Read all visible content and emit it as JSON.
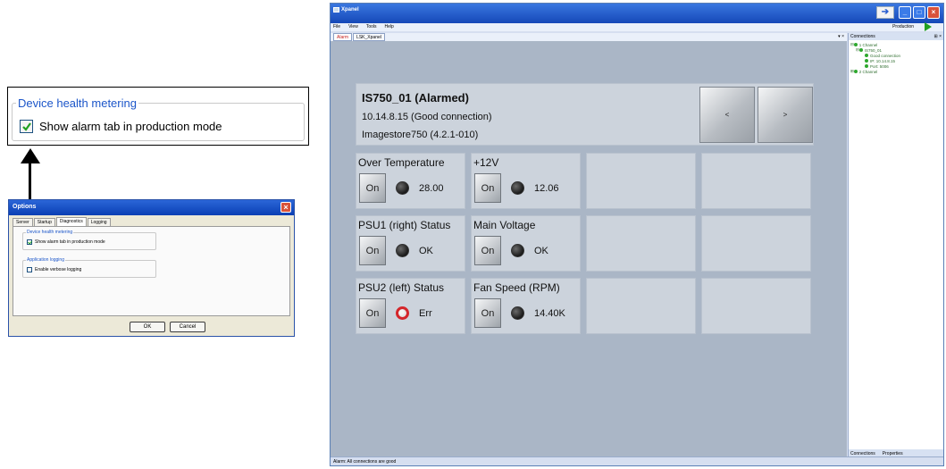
{
  "callout": {
    "legend": "Device health metering",
    "checkbox_label": "Show alarm tab in production mode",
    "checked": true
  },
  "options_dialog": {
    "title": "Options",
    "tabs": [
      "Server",
      "Startup",
      "Diagnostics",
      "Logging"
    ],
    "active_tab": "Diagnostics",
    "group1_legend": "Device health metering",
    "group1_checkbox": "Show alarm tab in production mode",
    "group2_legend": "Application logging",
    "group2_checkbox": "Enable verbose logging",
    "ok": "OK",
    "cancel": "Cancel"
  },
  "xpanel": {
    "title": "Xpanel",
    "menu": [
      "File",
      "View",
      "Tools",
      "Help"
    ],
    "mode_label": "Production",
    "tabs": [
      "Alarm",
      "LSK_Xpanel"
    ],
    "tab_tools": "▾ ×",
    "status": "Alarm: All connections are good",
    "device": {
      "name": "IS750_01 (Alarmed)",
      "ip": "10.14.8.15 (Good connection)",
      "model": "Imagestore750 (4.2.1-010)",
      "prev": "<",
      "next": ">"
    },
    "tiles": [
      {
        "title": "Over Temperature",
        "button": "On",
        "value": "28.00",
        "led": "off"
      },
      {
        "title": "+12V",
        "button": "On",
        "value": "12.06",
        "led": "off"
      },
      {
        "title": "PSU1 (right) Status",
        "button": "On",
        "value": "OK",
        "led": "off"
      },
      {
        "title": "Main Voltage",
        "button": "On",
        "value": "OK",
        "led": "off"
      },
      {
        "title": "PSU2 (left) Status",
        "button": "On",
        "value": "Err",
        "led": "alarm"
      },
      {
        "title": "Fan Speed (RPM)",
        "button": "On",
        "value": "14.40K",
        "led": "off"
      }
    ],
    "connections": {
      "header": "Connections",
      "tree": [
        "1 Channel",
        "IS750_01",
        "Good connection",
        "IP: 10.14.8.15",
        "Port: 5006",
        "2 Channel"
      ],
      "footer_tabs": [
        "Connections",
        "Properties"
      ]
    }
  }
}
